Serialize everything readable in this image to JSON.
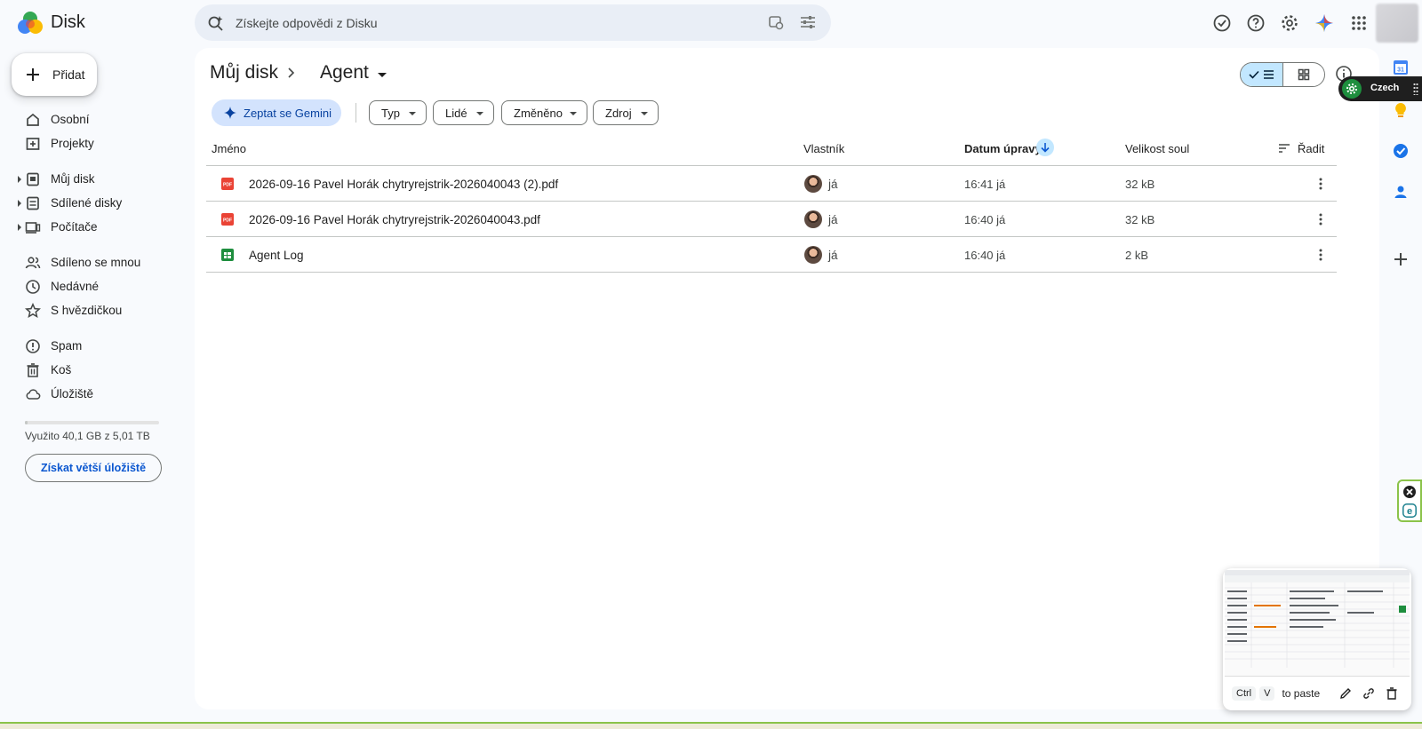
{
  "app": {
    "brand": "Disk"
  },
  "search": {
    "placeholder": "Získejte odpovědi z Disku"
  },
  "sidebar": {
    "new_label": "Přidat",
    "items": [
      {
        "label": "Osobní",
        "icon": "home-icon",
        "expandable": false
      },
      {
        "label": "Projekty",
        "icon": "projects-icon",
        "expandable": false
      },
      {
        "label": "Můj disk",
        "icon": "drive-icon",
        "expandable": true
      },
      {
        "label": "Sdílené disky",
        "icon": "shared-drives-icon",
        "expandable": true
      },
      {
        "label": "Počítače",
        "icon": "computers-icon",
        "expandable": true
      },
      {
        "label": "Sdíleno se mnou",
        "icon": "people-icon",
        "expandable": false
      },
      {
        "label": "Nedávné",
        "icon": "clock-icon",
        "expandable": false
      },
      {
        "label": "S hvězdičkou",
        "icon": "star-icon",
        "expandable": false
      },
      {
        "label": "Spam",
        "icon": "spam-icon",
        "expandable": false
      },
      {
        "label": "Koš",
        "icon": "trash-icon",
        "expandable": false
      },
      {
        "label": "Úložiště",
        "icon": "cloud-icon",
        "expandable": false
      }
    ],
    "storage": {
      "text": "Využito 40,1 GB z 5,01 TB",
      "used_fraction": 0.008,
      "button_label": "Získat větší úložiště"
    }
  },
  "breadcrumb": {
    "root": "Můj disk",
    "current": "Agent"
  },
  "toolbar": {
    "gemini_label": "Zeptat se Gemini",
    "filters": [
      "Typ",
      "Lidé",
      "Změněno",
      "Zdroj"
    ]
  },
  "table": {
    "headers": {
      "name": "Jméno",
      "owner": "Vlastník",
      "modified": "Datum úpravy",
      "size": "Velikost soul",
      "sort": "Řadit"
    },
    "rows": [
      {
        "name": "2026-09-16 Pavel Horák chytryrejstrik-2026040043 (2).pdf",
        "type": "pdf",
        "owner": "já",
        "modified": "16:41 já",
        "size": "32 kB"
      },
      {
        "name": "2026-09-16 Pavel Horák chytryrejstrik-2026040043.pdf",
        "type": "pdf",
        "owner": "já",
        "modified": "16:40 já",
        "size": "32 kB"
      },
      {
        "name": "Agent Log",
        "type": "sheet",
        "owner": "já",
        "modified": "16:40 já",
        "size": "2 kB"
      }
    ]
  },
  "right_panel": {
    "calendar_day": "31",
    "language_label": "Czech"
  },
  "clipboard": {
    "key1": "Ctrl",
    "key2": "V",
    "hint": "to paste"
  },
  "colors": {
    "accent": "#0b57d0",
    "selected": "#c2e7ff",
    "pdf": "#ea4335",
    "sheet": "#1e8e3e"
  }
}
